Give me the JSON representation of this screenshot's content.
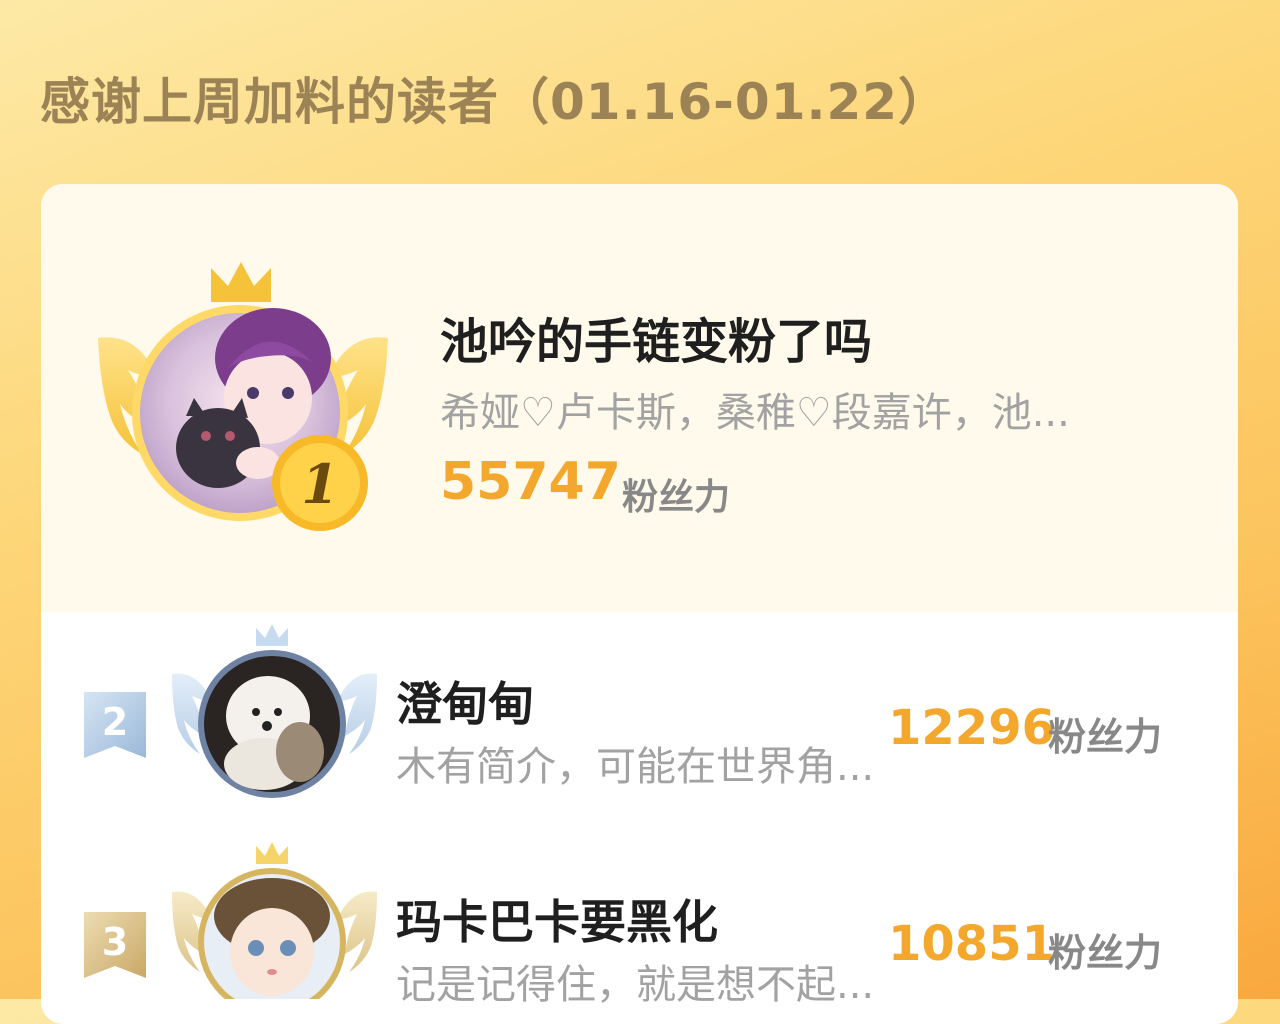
{
  "header": {
    "title": "感谢上周加料的读者（01.16-01.22）"
  },
  "leaderboard": {
    "top": {
      "rank": "1",
      "name": "池吟的手链变粉了吗",
      "bio": "希娅♡卢卡斯，桑稚♡段嘉许，池...",
      "score": "55747",
      "unit": "粉丝力"
    },
    "rows": [
      {
        "rank": "2",
        "name": "澄甸甸",
        "bio": "木有简介，可能在世界角...",
        "score": "12296",
        "unit": "粉丝力"
      },
      {
        "rank": "3",
        "name": "玛卡巴卡要黑化",
        "bio": "记是记得住，就是想不起...",
        "score": "10851",
        "unit": "粉丝力"
      }
    ]
  },
  "colors": {
    "background_accent": "#fcc35c",
    "score": "#f3a82d",
    "gold": "#f5c33a",
    "silver": "#a9c4e0",
    "bronze": "#d9c08a"
  },
  "icons": [
    "crown-icon",
    "wings-icon",
    "rank-medal-icon",
    "rank-ribbon-icon"
  ]
}
